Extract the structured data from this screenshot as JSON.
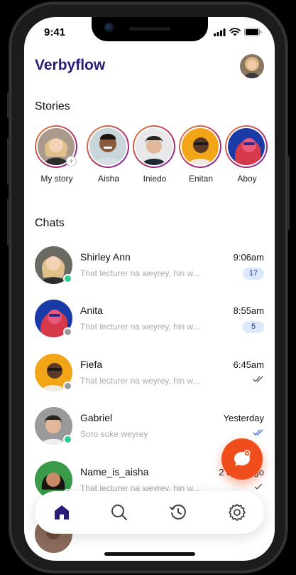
{
  "status_bar": {
    "time": "9:41"
  },
  "app": {
    "title": "Verbyflow"
  },
  "stories": {
    "title": "Stories",
    "items": [
      {
        "name": "My story",
        "avatar": "blonde woman",
        "has_add": true
      },
      {
        "name": "Aisha",
        "avatar": "smiling man"
      },
      {
        "name": "Iniedo",
        "avatar": "young man dark hair"
      },
      {
        "name": "Enitan",
        "avatar": "man on yellow"
      },
      {
        "name": "Aboy",
        "avatar": "person neon"
      }
    ]
  },
  "chats": {
    "title": "Chats",
    "items": [
      {
        "name": "Shirley Ann",
        "message": "That lecturer na weyrey, hin w...",
        "time": "9:06am",
        "unread": "17",
        "presence": "online"
      },
      {
        "name": "Anita",
        "message": "That lecturer na weyrey, hin w...",
        "time": "8:55am",
        "unread": "5",
        "presence": "offline"
      },
      {
        "name": "Fiefa",
        "message": "That lecturer na weyrey, hin w...",
        "time": "6:45am",
        "unread": "",
        "presence": "offline",
        "status": "read"
      },
      {
        "name": "Gabriel",
        "message": "Soro soke weyrey",
        "time": "Yesterday",
        "unread": "",
        "presence": "online",
        "status": "read-blue"
      },
      {
        "name": "Name_is_aisha",
        "message": "That lecturer na weyrey, hin w...",
        "time": "2 days ago",
        "unread": "",
        "presence": "offline",
        "status": "sent"
      }
    ]
  },
  "colors": {
    "brand": "#2a1a7a",
    "fab": "#f04d1c",
    "online": "#2ecc8f",
    "offline": "#9a9a9a",
    "unread_bg": "#dce8fb"
  },
  "nav": {
    "items": [
      "home-icon",
      "search-icon",
      "history-icon",
      "settings-icon"
    ],
    "active": "home-icon"
  }
}
